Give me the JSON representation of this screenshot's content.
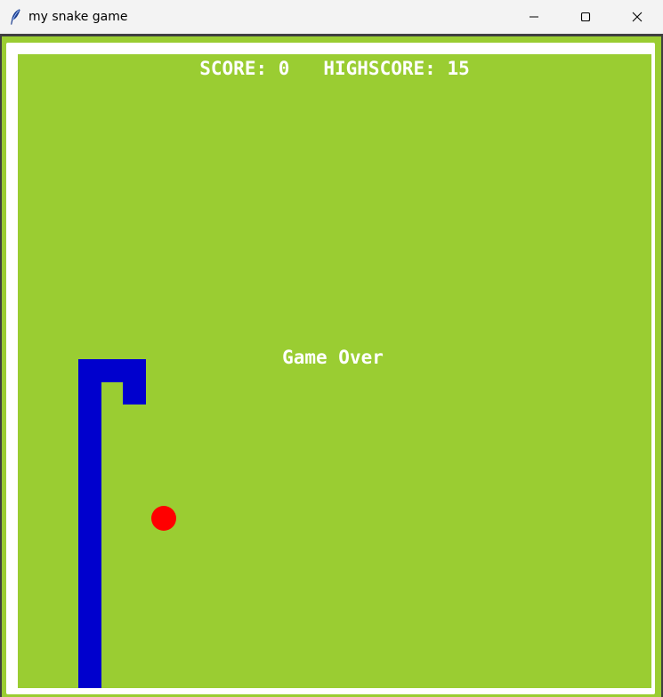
{
  "window": {
    "title": "my snake game",
    "icon": "feather-icon",
    "controls": {
      "minimize_icon": "minimize-icon",
      "maximize_icon": "maximize-icon",
      "close_icon": "close-icon"
    }
  },
  "game": {
    "score_label": "SCORE:",
    "score": "0",
    "highscore_label": "HIGHSCORE:",
    "highscore": "15",
    "status": "Game Over"
  },
  "colors": {
    "board": "#9acd32",
    "snake": "#0000cd",
    "food": "#ff0000",
    "text": "#ffffff"
  }
}
